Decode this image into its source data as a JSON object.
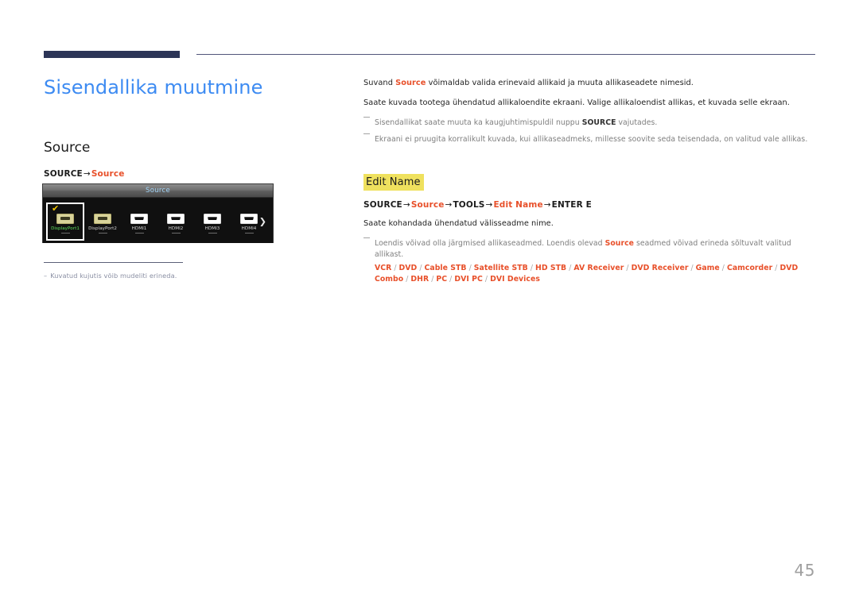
{
  "page": {
    "number": "45"
  },
  "left": {
    "title": "Sisendallika muutmine",
    "section_title": "Source",
    "path": {
      "root": "SOURCE",
      "arrow": "→",
      "target": "Source"
    },
    "footnote": {
      "dash": "–",
      "text": "Kuvatud kujutis võib mudeliti erineda."
    }
  },
  "osd": {
    "title": "Source",
    "next_arrow_icon": "chevron-right-icon",
    "check_icon": "✔",
    "items": [
      {
        "label": "DisplayPort1",
        "type": "dp",
        "selected": true
      },
      {
        "label": "DisplayPort2",
        "type": "dp",
        "selected": false
      },
      {
        "label": "HDMI1",
        "type": "hdmi",
        "selected": false
      },
      {
        "label": "HDMI2",
        "type": "hdmi",
        "selected": false
      },
      {
        "label": "HDMI3",
        "type": "hdmi",
        "selected": false
      },
      {
        "label": "HDMI4",
        "type": "hdmi",
        "selected": false
      }
    ]
  },
  "right": {
    "intro_para_1": {
      "before": "Suvand ",
      "accent": "Source",
      "after": " võimaldab valida erinevaid allikaid ja muuta allikaseadete nimesid."
    },
    "intro_para_2": "Saate kuvada tootega ühendatud allikaloendite ekraani. Valige allikaloendist allikas, et kuvada selle ekraan.",
    "note_1": {
      "before": "Sisendallikat saate muuta ka kaugjuhtimispuldil nuppu ",
      "strong": "SOURCE",
      "after": " vajutades."
    },
    "note_2": "Ekraani ei pruugita korralikult kuvada, kui allikaseadmeks, millesse soovite seda teisendada, on valitud vale allikas.",
    "edit_name": {
      "heading": "Edit Name",
      "path": {
        "p1": "SOURCE",
        "a1": "→",
        "p2": "Source",
        "a2": "→",
        "p3": "TOOLS",
        "a3": "→",
        "p4": "Edit Name",
        "a4": "→",
        "p5": "ENTER E"
      },
      "para": "Saate kohandada ühendatud välisseadme nime.",
      "note": {
        "before": "Loendis võivad olla järgmised allikaseadmed. Loendis olevad ",
        "accent": "Source",
        "after": " seadmed võivad erineda sõltuvalt valitud allikast."
      },
      "devices": [
        "VCR",
        "DVD",
        "Cable STB",
        "Satellite STB",
        "HD STB",
        "AV Receiver",
        "DVD Receiver",
        "Game",
        "Camcorder",
        "DVD Combo",
        "DHR",
        "PC",
        "DVI PC",
        "DVI Devices"
      ],
      "device_separator": " / "
    }
  },
  "colors": {
    "title_blue": "#3d8bf2",
    "accent_orange": "#e8502a",
    "rule_navy": "#2c3557",
    "highlight_yellow": "#efe15e",
    "note_gray": "#7e7e7e"
  }
}
